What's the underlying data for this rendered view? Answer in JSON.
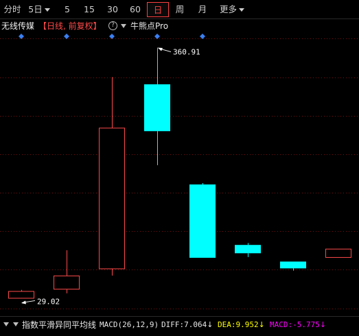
{
  "toolbar": {
    "tabs": [
      {
        "label": "分时",
        "active": false,
        "has_dropdown": false
      },
      {
        "label": "5日",
        "active": false,
        "has_dropdown": true
      },
      {
        "label": "5",
        "active": false,
        "has_dropdown": false
      },
      {
        "label": "15",
        "active": false,
        "has_dropdown": false
      },
      {
        "label": "30",
        "active": false,
        "has_dropdown": false
      },
      {
        "label": "60",
        "active": false,
        "has_dropdown": false
      },
      {
        "label": "日",
        "active": true,
        "has_dropdown": false
      },
      {
        "label": "周",
        "active": false,
        "has_dropdown": false
      },
      {
        "label": "月",
        "active": false,
        "has_dropdown": false
      },
      {
        "label": "更多",
        "active": false,
        "has_dropdown": true
      }
    ]
  },
  "info": {
    "stock_name": "无线传媒",
    "period_label": "【日线, 前复权】",
    "help_glyph": "?",
    "bull_bear_label": "牛熊点Pro"
  },
  "colors": {
    "up": "#ff4a4a",
    "down": "#00ffff",
    "grid": "#7a1010",
    "marker": "#3a7ef0",
    "annotation": "#ffffff",
    "dea": "#ffff00",
    "macd": "#ff00ff"
  },
  "chart_data": {
    "type": "candlestick",
    "candles": [
      {
        "open": 29.02,
        "close": 39.0,
        "high": 40.5,
        "low": 29.02
      },
      {
        "open": 41.0,
        "close": 59.5,
        "high": 93.0,
        "low": 36.0
      },
      {
        "open": 68.0,
        "close": 255.0,
        "high": 322.0,
        "low": 59.5
      },
      {
        "open": 312.5,
        "close": 250.5,
        "high": 360.91,
        "low": 205.5
      },
      {
        "open": 180.0,
        "close": 83.0,
        "high": 181.8,
        "low": 83.0
      },
      {
        "open": 100.0,
        "close": 89.0,
        "high": 102.5,
        "low": 84.0
      },
      {
        "open": 78.0,
        "close": 69.0,
        "high": 78.0,
        "low": 66.0
      },
      {
        "open": 83.0,
        "close": 95.0,
        "high": 95.0,
        "low": 83.0
      }
    ],
    "max_label": "360.91",
    "min_label": "29.02",
    "markers": [
      0,
      1,
      2,
      3,
      4
    ],
    "ylim": [
      14,
      385
    ]
  },
  "indicator": {
    "name_label": "指数平滑异同平均线",
    "params": "MACD(26,12,9)",
    "diff": "DIFF:7.064",
    "dea": "DEA:9.952",
    "macd": "MACD:-5.775",
    "down_glyph": "↓"
  }
}
